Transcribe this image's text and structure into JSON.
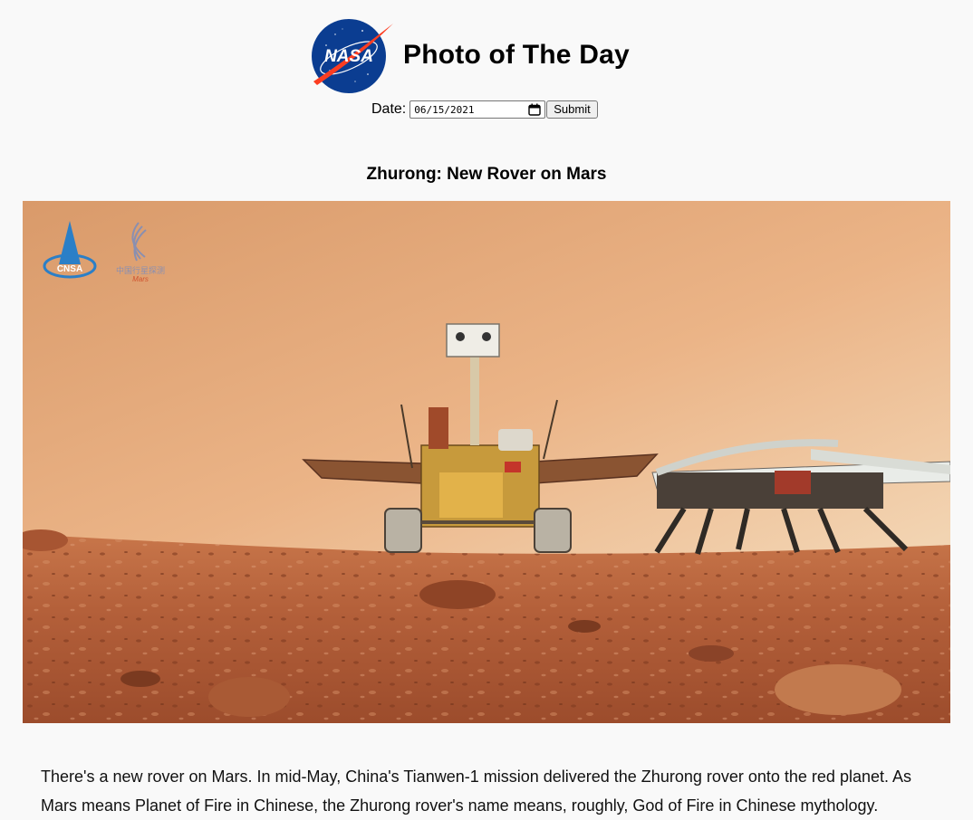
{
  "header": {
    "logo_label": "NASA",
    "title": "Photo of The Day"
  },
  "date_form": {
    "label": "Date:",
    "value": "06/15/2021",
    "submit_label": "Submit"
  },
  "photo": {
    "title": "Zhurong: New Rover on Mars",
    "watermark_text": "中国行星探测",
    "watermark_sub": "Mars",
    "cnsa_label": "CNSA"
  },
  "explanation": "There's a new rover on Mars. In mid-May, China's Tianwen-1 mission delivered the Zhurong rover onto the red planet. As Mars means Planet of Fire in Chinese, the Zhurong rover's name means, roughly, God of Fire in Chinese mythology.",
  "colors": {
    "nasa_blue": "#0b3d91",
    "nasa_red": "#fc3d21",
    "sky": "#e2a06e",
    "ground": "#b5603a"
  }
}
